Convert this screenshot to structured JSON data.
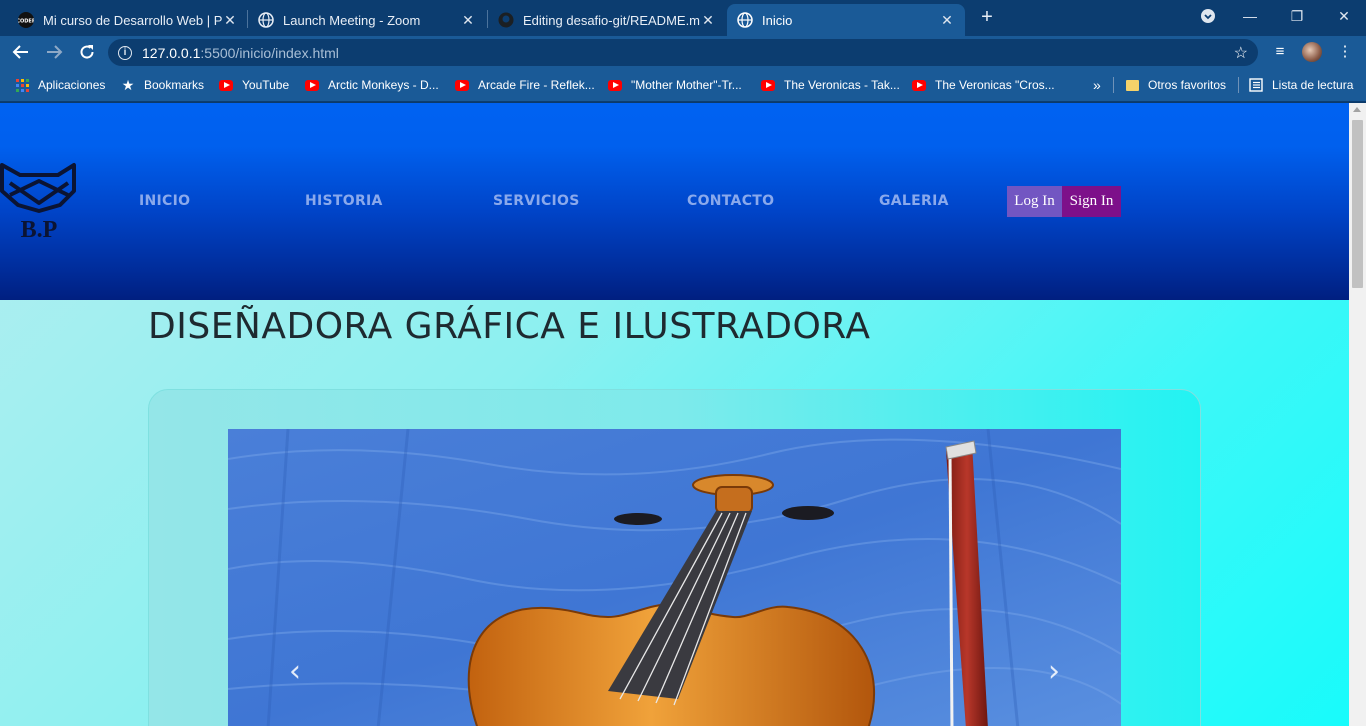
{
  "browser": {
    "tabs": [
      {
        "title": "Mi curso de Desarrollo Web | Plat",
        "favicon": "coderhouse-icon"
      },
      {
        "title": "Launch Meeting - Zoom",
        "favicon": "globe-icon"
      },
      {
        "title": "Editing desafio-git/README.md a",
        "favicon": "github-icon"
      },
      {
        "title": "Inicio",
        "favicon": "globe-icon",
        "active": true
      }
    ],
    "url_host": "127.0.0.1",
    "url_path": ":5500/inicio/index.html",
    "bookmarks": [
      {
        "label": "Aplicaciones",
        "icon": "apps-grid-icon"
      },
      {
        "label": "Bookmarks",
        "icon": "star-icon"
      },
      {
        "label": "YouTube",
        "icon": "youtube-icon"
      },
      {
        "label": "Arctic Monkeys - D...",
        "icon": "youtube-icon"
      },
      {
        "label": "Arcade Fire - Reflek...",
        "icon": "youtube-icon"
      },
      {
        "label": "\"Mother Mother\"-Tr...",
        "icon": "youtube-icon"
      },
      {
        "label": "The Veronicas - Tak...",
        "icon": "youtube-icon"
      },
      {
        "label": "The Veronicas \"Cros...",
        "icon": "youtube-icon"
      }
    ],
    "bookmarks_overflow": "»",
    "other_bookmarks": "Otros favoritos",
    "reading_list": "Lista de lectura"
  },
  "site": {
    "logo_text": "B.P",
    "nav": [
      "INICIO",
      "HISTORIA",
      "SERVICIOS",
      "CONTACTO",
      "GALERIA"
    ],
    "login_label": "Log In",
    "signin_label": "Sign In",
    "headline": "DISEÑADORA GRÁFICA E ILUSTRADORA",
    "carousel": {
      "image_subject": "violin-and-bow-on-blue-fabric",
      "prev_icon": "chevron-left-icon",
      "next_icon": "chevron-right-icon"
    }
  },
  "colors": {
    "browser_frame": "#0c3d70",
    "browser_toolbar": "#1a5a97",
    "header_top": "#0062f2",
    "header_bottom": "#001f80",
    "nav_text": "#8aa9ec",
    "login_bg": "#7256c2",
    "signin_bg": "#7d108a",
    "page_bg_start": "#b3eef0",
    "page_bg_end": "#18fbfb"
  }
}
